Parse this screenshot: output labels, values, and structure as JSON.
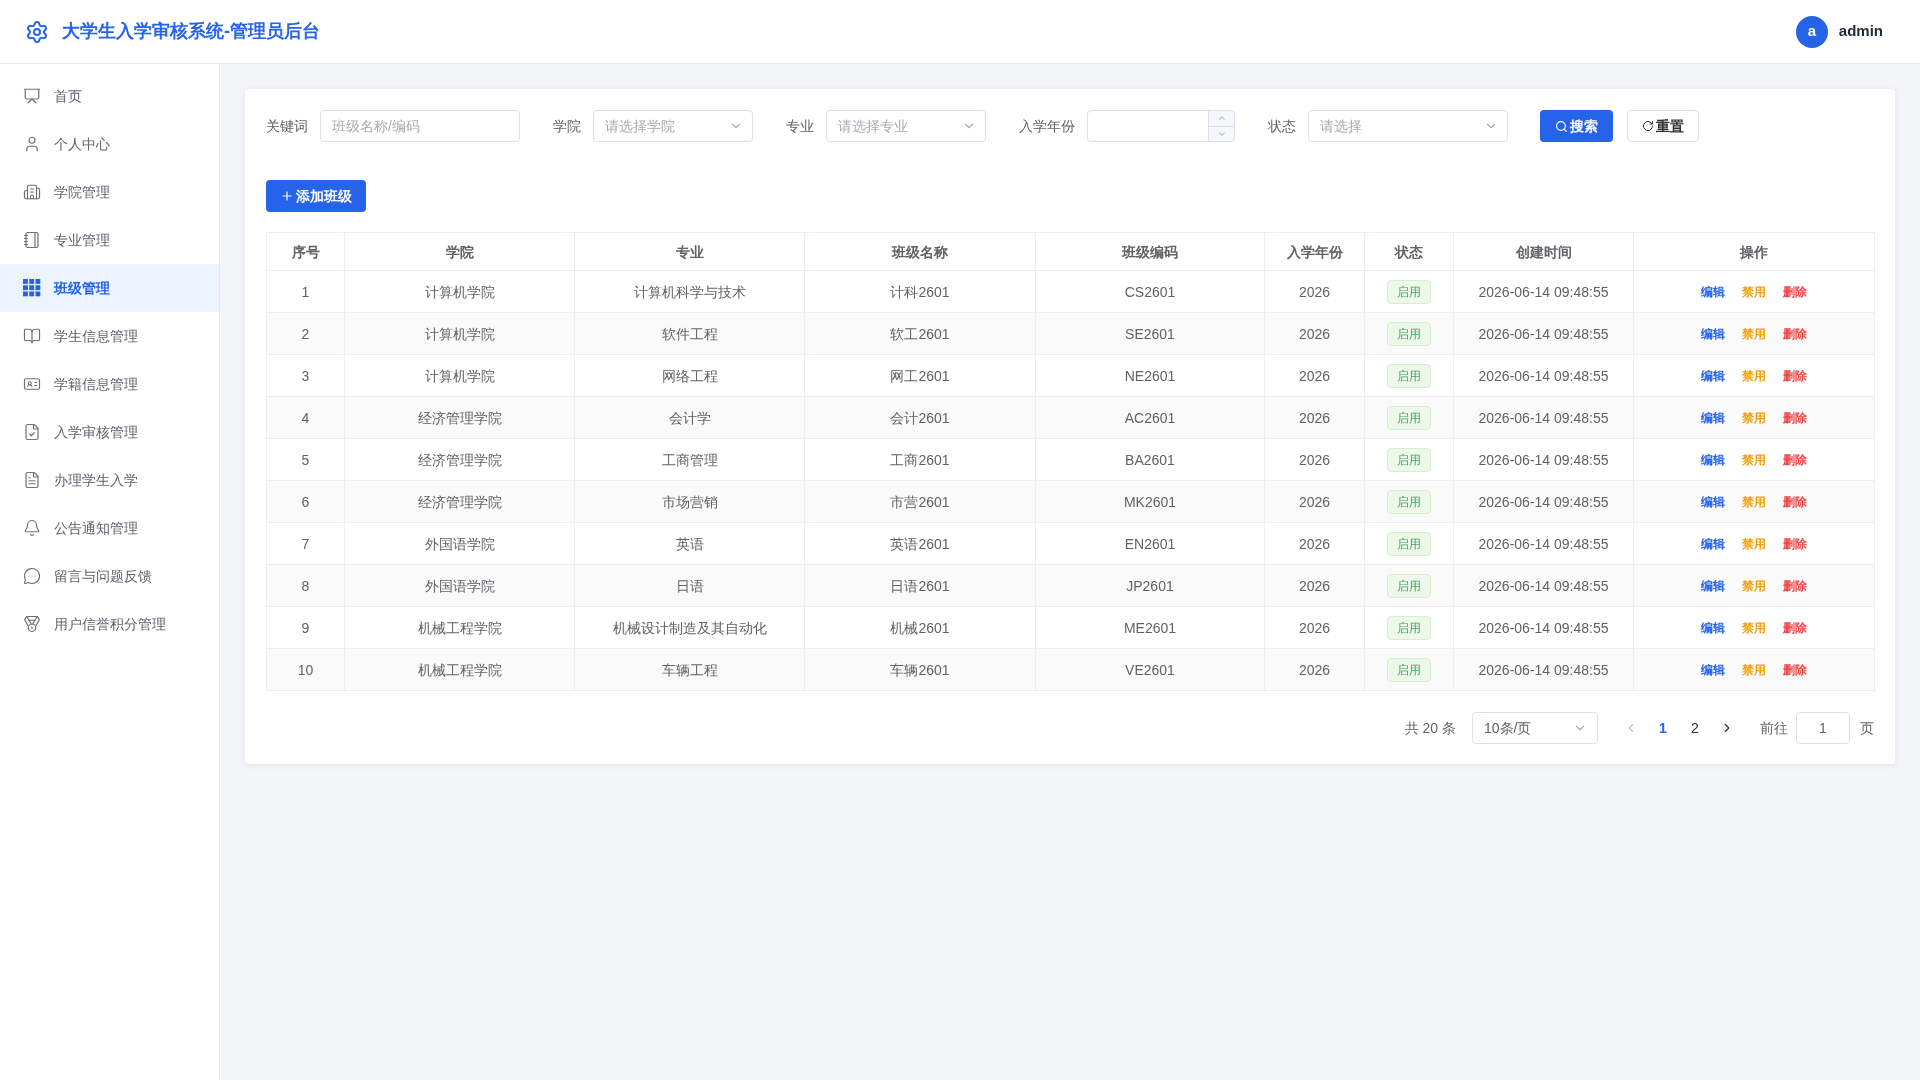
{
  "header": {
    "title": "大学生入学审核系统-管理员后台",
    "user": {
      "avatar": "a",
      "name": "admin"
    }
  },
  "sidebar": {
    "items": [
      {
        "label": "首页",
        "selected": false
      },
      {
        "label": "个人中心",
        "selected": false
      },
      {
        "label": "学院管理",
        "selected": false
      },
      {
        "label": "专业管理",
        "selected": false
      },
      {
        "label": "班级管理",
        "selected": true
      },
      {
        "label": "学生信息管理",
        "selected": false
      },
      {
        "label": "学籍信息管理",
        "selected": false
      },
      {
        "label": "入学审核管理",
        "selected": false
      },
      {
        "label": "办理学生入学",
        "selected": false
      },
      {
        "label": "公告通知管理",
        "selected": false
      },
      {
        "label": "留言与问题反馈",
        "selected": false
      },
      {
        "label": "用户信誉积分管理",
        "selected": false
      }
    ]
  },
  "filters": [
    {
      "label": "关键词",
      "kind": "text",
      "placeholder": "班级名称/编码"
    },
    {
      "label": "学院",
      "kind": "select",
      "placeholder": "请选择学院"
    },
    {
      "label": "专业",
      "kind": "select",
      "placeholder": "请选择专业"
    },
    {
      "label": "入学年份",
      "kind": "number"
    },
    {
      "label": "状态",
      "kind": "select",
      "placeholder": "请选择"
    }
  ],
  "buttons": {
    "search": "搜索",
    "reset": "重置",
    "add": "添加班级"
  },
  "table": {
    "columns": [
      "序号",
      "学院",
      "专业",
      "班级名称",
      "班级编码",
      "入学年份",
      "状态",
      "创建时间",
      "操作"
    ],
    "rows": [
      {
        "cells": [
          "1",
          "计算机学院",
          "计算机科学与技术",
          "计科2601",
          "CS2601",
          "2026"
        ],
        "status": {
          "label": "启用",
          "enabled": true
        },
        "created": "2026-06-14 09:48:55",
        "actions": [
          {
            "label": "编辑",
            "kind": "edit"
          },
          {
            "label": "禁用",
            "kind": "disable"
          },
          {
            "label": "删除",
            "kind": "delete"
          }
        ]
      },
      {
        "cells": [
          "2",
          "计算机学院",
          "软件工程",
          "软工2601",
          "SE2601",
          "2026"
        ],
        "status": {
          "label": "启用",
          "enabled": true
        },
        "created": "2026-06-14 09:48:55",
        "actions": [
          {
            "label": "编辑",
            "kind": "edit"
          },
          {
            "label": "禁用",
            "kind": "disable"
          },
          {
            "label": "删除",
            "kind": "delete"
          }
        ]
      },
      {
        "cells": [
          "3",
          "计算机学院",
          "网络工程",
          "网工2601",
          "NE2601",
          "2026"
        ],
        "status": {
          "label": "启用",
          "enabled": true
        },
        "created": "2026-06-14 09:48:55",
        "actions": [
          {
            "label": "编辑",
            "kind": "edit"
          },
          {
            "label": "禁用",
            "kind": "disable"
          },
          {
            "label": "删除",
            "kind": "delete"
          }
        ]
      },
      {
        "cells": [
          "4",
          "经济管理学院",
          "会计学",
          "会计2601",
          "AC2601",
          "2026"
        ],
        "status": {
          "label": "启用",
          "enabled": true
        },
        "created": "2026-06-14 09:48:55",
        "actions": [
          {
            "label": "编辑",
            "kind": "edit"
          },
          {
            "label": "禁用",
            "kind": "disable"
          },
          {
            "label": "删除",
            "kind": "delete"
          }
        ]
      },
      {
        "cells": [
          "5",
          "经济管理学院",
          "工商管理",
          "工商2601",
          "BA2601",
          "2026"
        ],
        "status": {
          "label": "启用",
          "enabled": true
        },
        "created": "2026-06-14 09:48:55",
        "actions": [
          {
            "label": "编辑",
            "kind": "edit"
          },
          {
            "label": "禁用",
            "kind": "disable"
          },
          {
            "label": "删除",
            "kind": "delete"
          }
        ]
      },
      {
        "cells": [
          "6",
          "经济管理学院",
          "市场营销",
          "市营2601",
          "MK2601",
          "2026"
        ],
        "status": {
          "label": "启用",
          "enabled": true
        },
        "created": "2026-06-14 09:48:55",
        "actions": [
          {
            "label": "编辑",
            "kind": "edit"
          },
          {
            "label": "禁用",
            "kind": "disable"
          },
          {
            "label": "删除",
            "kind": "delete"
          }
        ]
      },
      {
        "cells": [
          "7",
          "外国语学院",
          "英语",
          "英语2601",
          "EN2601",
          "2026"
        ],
        "status": {
          "label": "启用",
          "enabled": true
        },
        "created": "2026-06-14 09:48:55",
        "actions": [
          {
            "label": "编辑",
            "kind": "edit"
          },
          {
            "label": "禁用",
            "kind": "disable"
          },
          {
            "label": "删除",
            "kind": "delete"
          }
        ]
      },
      {
        "cells": [
          "8",
          "外国语学院",
          "日语",
          "日语2601",
          "JP2601",
          "2026"
        ],
        "status": {
          "label": "启用",
          "enabled": true
        },
        "created": "2026-06-14 09:48:55",
        "actions": [
          {
            "label": "编辑",
            "kind": "edit"
          },
          {
            "label": "禁用",
            "kind": "disable"
          },
          {
            "label": "删除",
            "kind": "delete"
          }
        ]
      },
      {
        "cells": [
          "9",
          "机械工程学院",
          "机械设计制造及其自动化",
          "机械2601",
          "ME2601",
          "2026"
        ],
        "status": {
          "label": "启用",
          "enabled": true
        },
        "created": "2026-06-14 09:48:55",
        "actions": [
          {
            "label": "编辑",
            "kind": "edit"
          },
          {
            "label": "禁用",
            "kind": "disable"
          },
          {
            "label": "删除",
            "kind": "delete"
          }
        ]
      },
      {
        "cells": [
          "10",
          "机械工程学院",
          "车辆工程",
          "车辆2601",
          "VE2601",
          "2026"
        ],
        "status": {
          "label": "启用",
          "enabled": true
        },
        "created": "2026-06-14 09:48:55",
        "actions": [
          {
            "label": "编辑",
            "kind": "edit"
          },
          {
            "label": "禁用",
            "kind": "disable"
          },
          {
            "label": "删除",
            "kind": "delete"
          }
        ]
      }
    ]
  },
  "pagination": {
    "total": "共 20 条",
    "page_size": "10条/页",
    "prev": {
      "disabled": true
    },
    "pages": [
      {
        "label": "1",
        "selected": true
      },
      {
        "label": "2",
        "selected": false
      }
    ],
    "next": {
      "disabled": false
    },
    "goto_label": "前往",
    "goto_value": "1",
    "goto_suffix": "页"
  }
}
